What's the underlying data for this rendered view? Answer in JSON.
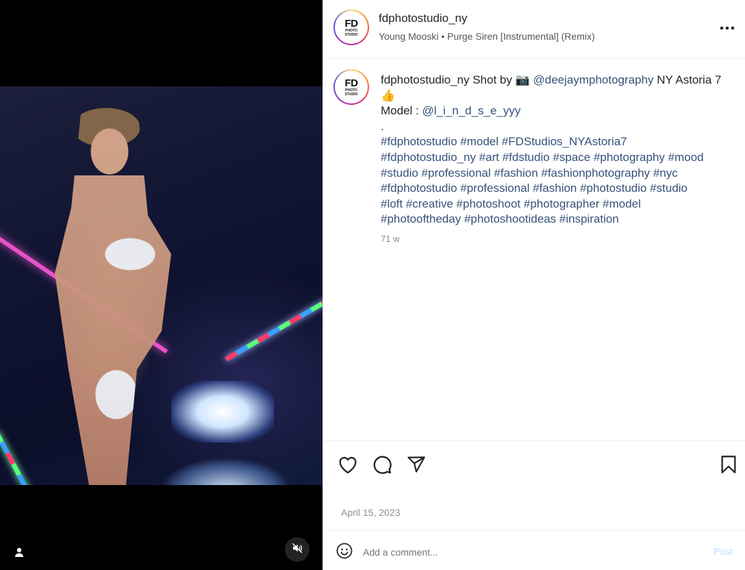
{
  "post": {
    "username": "fdphotostudio_ny",
    "audio": "Young Mooski • Purge Siren [Instrumental] (Remix)",
    "avatar": {
      "line1": "FD",
      "line2": "PHOTO",
      "line3": "STUDIO"
    },
    "caption": {
      "username": "fdphotostudio_ny",
      "lines": [
        {
          "text": " Shot by 📷 "
        },
        {
          "link": "@deejaymphotography"
        },
        {
          "text": " NY Astoria 7👍"
        },
        {
          "text": "Model : "
        },
        {
          "link": "@l_i_n_d_s_e_yyy"
        },
        {
          "text": "."
        }
      ],
      "hashtags": [
        "#fdphotostudio #model #FDStudios_NYAstoria7",
        "#fdphotostudio_ny #art #fdstudio #space #photography #mood",
        "#studio #professional #fashion #fashionphotography #nyc",
        "#fdphotostudio #professional #fashion #photostudio #studio",
        "#loft #creative #photoshoot #photographer #model",
        "#photooftheday #photoshootideas  #inspiration"
      ],
      "time_ago": "71 w"
    },
    "date": "April 15, 2023",
    "comment": {
      "placeholder": "Add a comment...",
      "post_label": "Post"
    }
  },
  "icons": {
    "more": "more-horizontal-icon",
    "like": "heart-icon",
    "comment": "comment-icon",
    "share": "send-icon",
    "save": "bookmark-icon",
    "emoji": "emoji-icon",
    "mute": "muted-speaker-icon",
    "user_tag": "user-tag-icon"
  },
  "colors": {
    "link": "#36527a",
    "muted": "#8e8e8e",
    "post_disabled": "#c0dffd"
  }
}
